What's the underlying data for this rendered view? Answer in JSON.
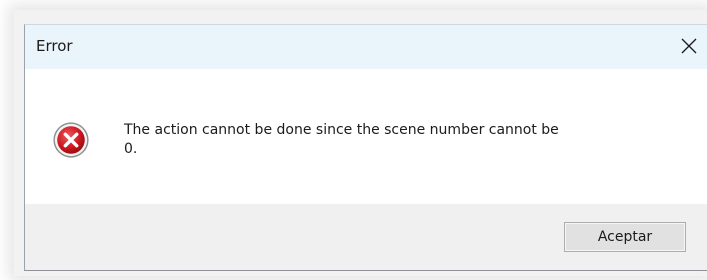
{
  "dialog": {
    "title": "Error",
    "message_line1": "The action cannot be done since the scene number cannot be",
    "message_line2": "0.",
    "ok_label": "Aceptar"
  },
  "icons": {
    "close": "close-icon",
    "error": "error-icon"
  },
  "colors": {
    "titlebar_bg": "#eaf4fb",
    "footer_bg": "#f0f0f0",
    "error_red": "#c9141e",
    "button_bg": "#e1e1e1"
  }
}
